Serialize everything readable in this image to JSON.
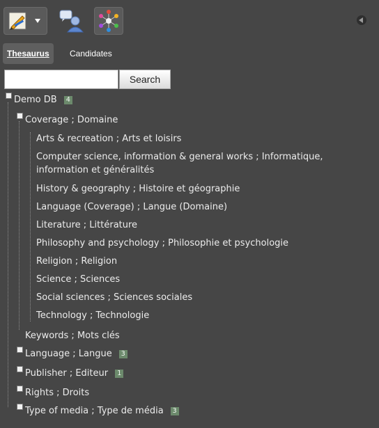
{
  "toolbar": {
    "edit_icon": "edit-pencil-icon",
    "users_icon": "users-chat-icon",
    "network_icon": "network-star-icon"
  },
  "tabs": [
    {
      "label": "Thesaurus"
    },
    {
      "label": "Candidates"
    }
  ],
  "search": {
    "value": "",
    "placeholder": "",
    "button_label": "Search"
  },
  "tree": {
    "root": {
      "label": "Demo DB",
      "badge": "4"
    },
    "coverage": {
      "label": "Coverage ; Domaine",
      "children": [
        "Arts & recreation ; Arts et loisirs",
        "Computer science, information & general works ; Informatique, information et généralités",
        "History & geography ; Histoire et géographie",
        "Language (Coverage) ; Langue (Domaine)",
        "Literature ; Littérature",
        "Philosophy and psychology ; Philosophie et psychologie",
        "Religion ; Religion",
        "Science ; Sciences",
        "Social sciences ; Sciences sociales",
        "Technology ; Technologie"
      ]
    },
    "keywords": {
      "label": "Keywords ; Mots clés"
    },
    "language": {
      "label": "Language ; Langue",
      "badge": "3"
    },
    "publisher": {
      "label": "Publisher ; Editeur",
      "badge": "1"
    },
    "rights": {
      "label": "Rights ; Droits"
    },
    "type": {
      "label": "Type of media ; Type de média",
      "badge": "3"
    }
  }
}
